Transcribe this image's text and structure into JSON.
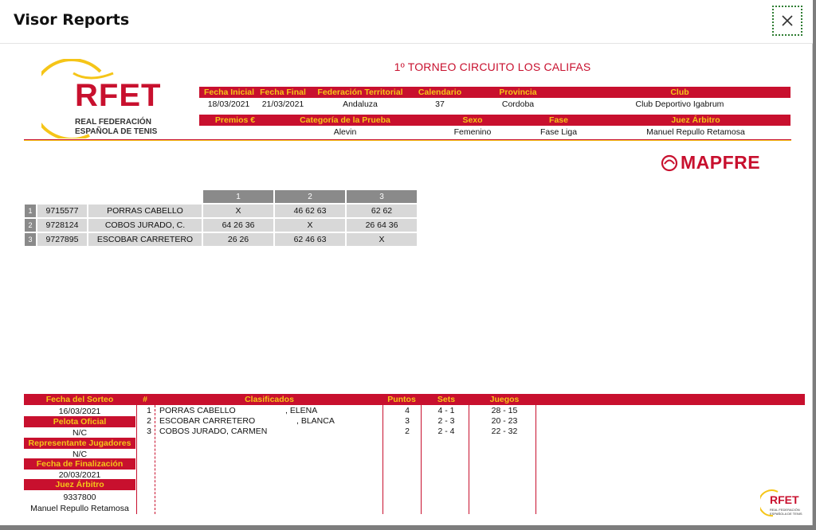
{
  "window": {
    "title": "Visor Reports"
  },
  "report": {
    "tournament_title": "1º TORNEO CIRCUITO  LOS CALIFAS",
    "logo": {
      "brand": "RFET",
      "line1": "REAL FEDERACIÓN",
      "line2": "ESPAÑOLA DE TENIS"
    },
    "sponsor": "MAPFRE",
    "info1": {
      "headers": [
        "Fecha Inicial",
        "Fecha Final",
        "Federación Territorial",
        "Calendario",
        "Provincia",
        "Club"
      ],
      "values": [
        "18/03/2021",
        "21/03/2021",
        "Andaluza",
        "37",
        "Cordoba",
        "Club Deportivo Igabrum"
      ]
    },
    "info2": {
      "headers": [
        "Premios €",
        "Categoría de la Prueba",
        "Sexo",
        "Fase",
        "Juez Árbitro"
      ],
      "values": [
        "",
        "Alevin",
        "Femenino",
        "Fase Liga",
        "Manuel Repullo Retamosa"
      ]
    },
    "matrix": {
      "columns": [
        "1",
        "2",
        "3"
      ],
      "rows": [
        {
          "n": "1",
          "id": "9715577",
          "name": "PORRAS CABELLO",
          "r": [
            "X",
            "46 62 63",
            "62 62"
          ]
        },
        {
          "n": "2",
          "id": "9728124",
          "name": "COBOS JURADO, C.",
          "r": [
            "64 26 36",
            "X",
            "26 64 36"
          ]
        },
        {
          "n": "3",
          "id": "9727895",
          "name": "ESCOBAR CARRETERO",
          "r": [
            "26 26",
            "62 46 63",
            "X"
          ]
        }
      ]
    },
    "side": {
      "fecha_sorteo_label": "Fecha del Sorteo",
      "fecha_sorteo": "16/03/2021",
      "pelota_label": "Pelota Oficial",
      "pelota": "N/C",
      "representante_label": "Representante Jugadores",
      "representante": "N/C",
      "finalizacion_label": "Fecha de Finalización",
      "finalizacion": "20/03/2021",
      "juez_label": "Juez Árbitro",
      "juez_id": "9337800",
      "juez_name": "Manuel Repullo Retamosa"
    },
    "standings": {
      "headers": {
        "num": "#",
        "clasificados": "Clasificados",
        "puntos": "Puntos",
        "sets": "Sets",
        "juegos": "Juegos"
      },
      "rows": [
        {
          "pos": "1",
          "surname": "PORRAS CABELLO",
          "first": ", ELENA",
          "puntos": "4",
          "sets": "4 - 1",
          "juegos": "28 - 15"
        },
        {
          "pos": "2",
          "surname": "ESCOBAR CARRETERO",
          "first": ", BLANCA",
          "puntos": "3",
          "sets": "2 - 3",
          "juegos": "20 - 23"
        },
        {
          "pos": "3",
          "surname": "COBOS JURADO, CARMEN",
          "first": "",
          "puntos": "2",
          "sets": "2 - 4",
          "juegos": "22 - 32"
        }
      ]
    },
    "colors": {
      "accent_red": "#c8102e",
      "accent_yellow": "#f5c518",
      "grey": "#8a8a8a"
    }
  }
}
